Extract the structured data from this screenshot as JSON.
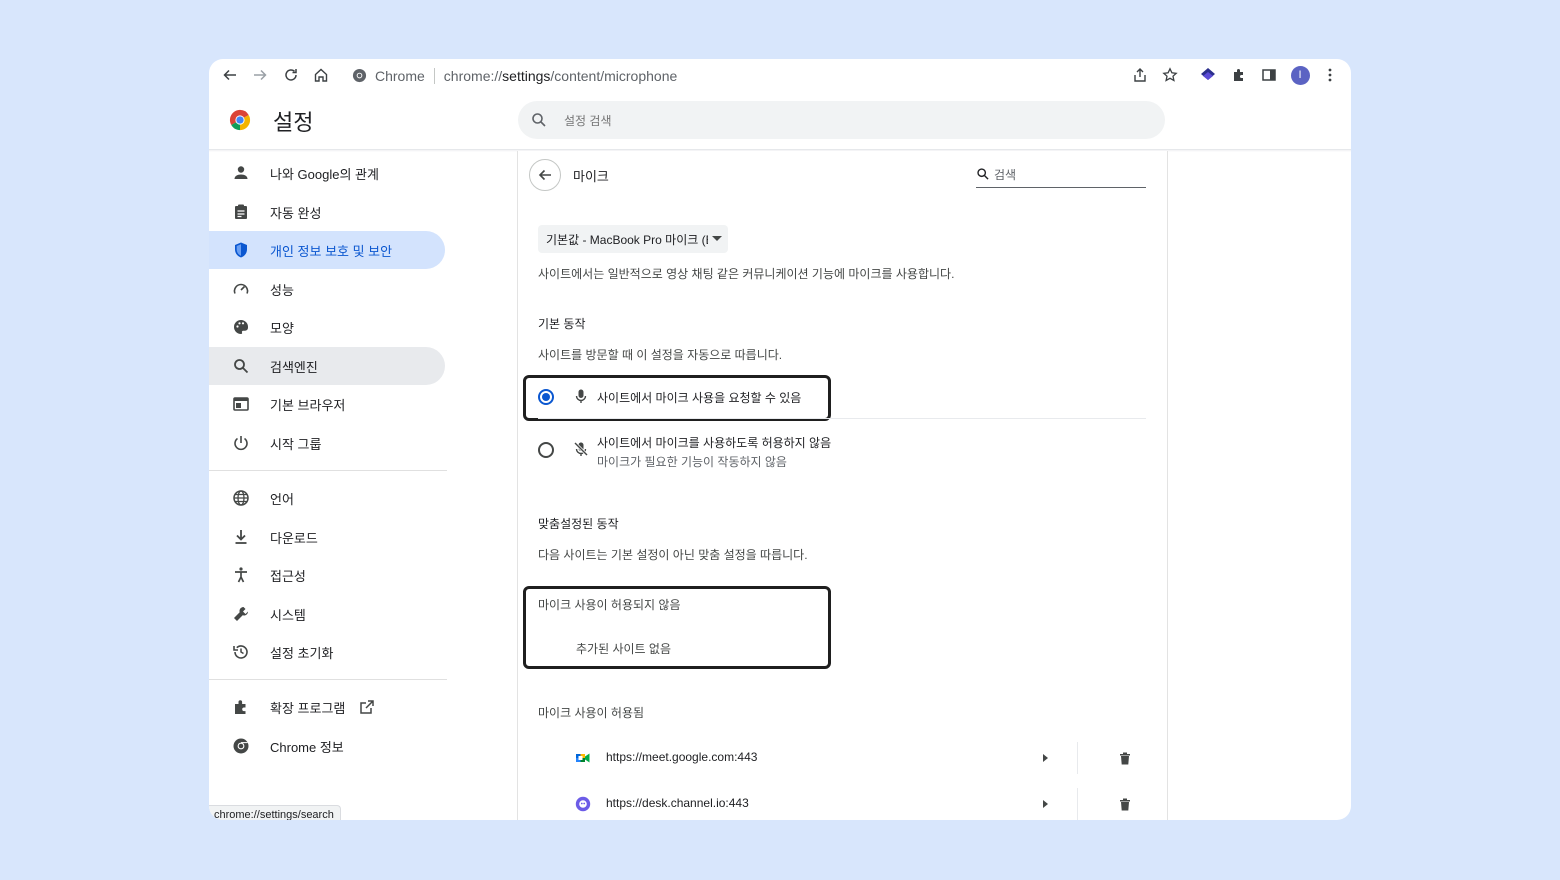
{
  "browser": {
    "site_chip": "Chrome",
    "url_prefix": "chrome://",
    "url_host": "settings",
    "url_path": "/content/microphone",
    "profile_initial": "I"
  },
  "header": {
    "title": "설정",
    "search_placeholder": "설정 검색"
  },
  "sidebar": {
    "items": [
      {
        "label": "나와 Google의 관계",
        "icon": "person-icon"
      },
      {
        "label": "자동 완성",
        "icon": "clipboard-icon"
      },
      {
        "label": "개인 정보 보호 및 보안",
        "icon": "shield-icon",
        "active": true
      },
      {
        "label": "성능",
        "icon": "speedometer-icon"
      },
      {
        "label": "모양",
        "icon": "palette-icon"
      },
      {
        "label": "검색엔진",
        "icon": "search-icon",
        "hover": true
      },
      {
        "label": "기본 브라우저",
        "icon": "browser-icon"
      },
      {
        "label": "시작 그룹",
        "icon": "power-icon"
      },
      {
        "label": "언어",
        "icon": "globe-icon"
      },
      {
        "label": "다운로드",
        "icon": "download-icon"
      },
      {
        "label": "접근성",
        "icon": "accessibility-icon"
      },
      {
        "label": "시스템",
        "icon": "wrench-icon"
      },
      {
        "label": "설정 초기화",
        "icon": "history-icon"
      },
      {
        "label": "확장 프로그램",
        "icon": "puzzle-icon"
      },
      {
        "label": "Chrome 정보",
        "icon": "chrome-icon"
      }
    ]
  },
  "status_bar": "chrome://settings/search",
  "main": {
    "page_title": "마이크",
    "search_placeholder": "검색",
    "device_select": "기본값 - MacBook Pro 마이크 (E",
    "description": "사이트에서는 일반적으로 영상 채팅 같은 커뮤니케이션 기능에 마이크를 사용합니다.",
    "default_behavior": {
      "title": "기본 동작",
      "description": "사이트를 방문할 때 이 설정을 자동으로 따릅니다.",
      "options": [
        {
          "label": "사이트에서 마이크 사용을 요청할 수 있음",
          "checked": true,
          "icon": "mic-icon"
        },
        {
          "label": "사이트에서 마이크를 사용하도록 허용하지 않음",
          "sublabel": "마이크가 필요한 기능이 작동하지 않음",
          "checked": false,
          "icon": "mic-off-icon"
        }
      ]
    },
    "custom_behavior": {
      "title": "맞춤설정된 동작",
      "description": "다음 사이트는 기본 설정이 아닌 맞춤 설정을 따릅니다.",
      "blocked_title": "마이크 사용이 허용되지 않음",
      "blocked_empty": "추가된 사이트 없음",
      "allowed_title": "마이크 사용이 허용됨",
      "allowed_sites": [
        {
          "url": "https://meet.google.com:443",
          "favicon": "google-meet-icon"
        },
        {
          "url": "https://desk.channel.io:443",
          "favicon": "channel-io-icon"
        }
      ]
    }
  },
  "colors": {
    "background": "#d8e6fc",
    "accent": "#0b57d0",
    "active_nav": "#d3e3fd"
  }
}
